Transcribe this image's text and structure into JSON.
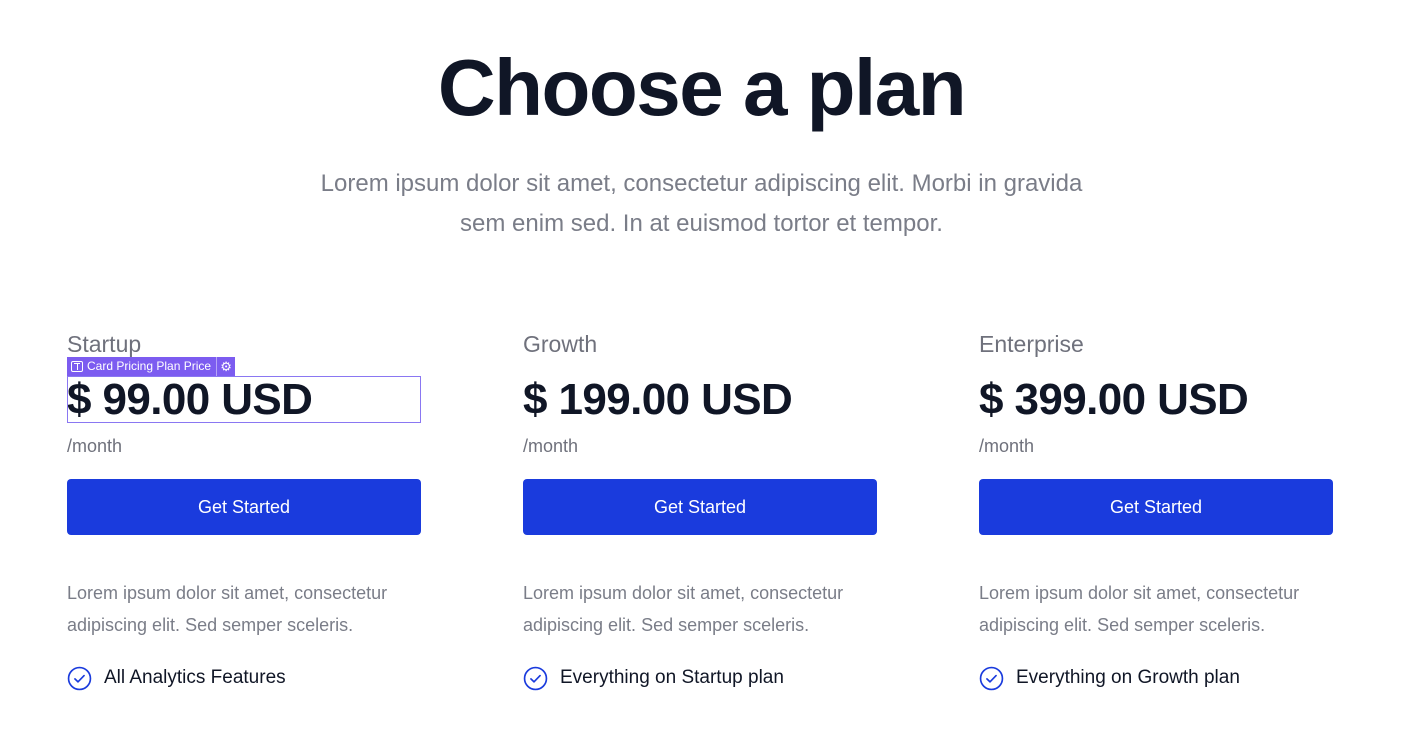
{
  "hero": {
    "title": "Choose a plan",
    "subtitle_line1": "Lorem ipsum dolor sit amet, consectetur adipiscing elit. Morbi in gravida",
    "subtitle_line2": "sem enim sed. In at euismod tortor et tempor."
  },
  "plans": [
    {
      "name": "Startup",
      "price": "$ 99.00 USD",
      "period": "/month",
      "button_label": "Get Started",
      "description": "Lorem ipsum dolor sit amet, consectetur adipiscing elit. Sed semper sceleris.",
      "feature": "All Analytics Features"
    },
    {
      "name": "Growth",
      "price": "$ 199.00 USD",
      "period": "/month",
      "button_label": "Get Started",
      "description": "Lorem ipsum dolor sit amet, consectetur adipiscing elit. Sed semper sceleris.",
      "feature": "Everything on Startup plan"
    },
    {
      "name": "Enterprise",
      "price": "$ 399.00 USD",
      "period": "/month",
      "button_label": "Get Started",
      "description": "Lorem ipsum dolor sit amet, consectetur adipiscing elit. Sed semper sceleris.",
      "feature": "Everything on Growth plan"
    }
  ],
  "editor": {
    "selected_label": "Card Pricing Plan Price",
    "type_icon": "text-type-icon",
    "settings_icon": "gear-icon"
  },
  "colors": {
    "accent": "#1a3bdd",
    "heading": "#101626",
    "muted": "#7a7d88",
    "selection": "#7c5cf0"
  }
}
